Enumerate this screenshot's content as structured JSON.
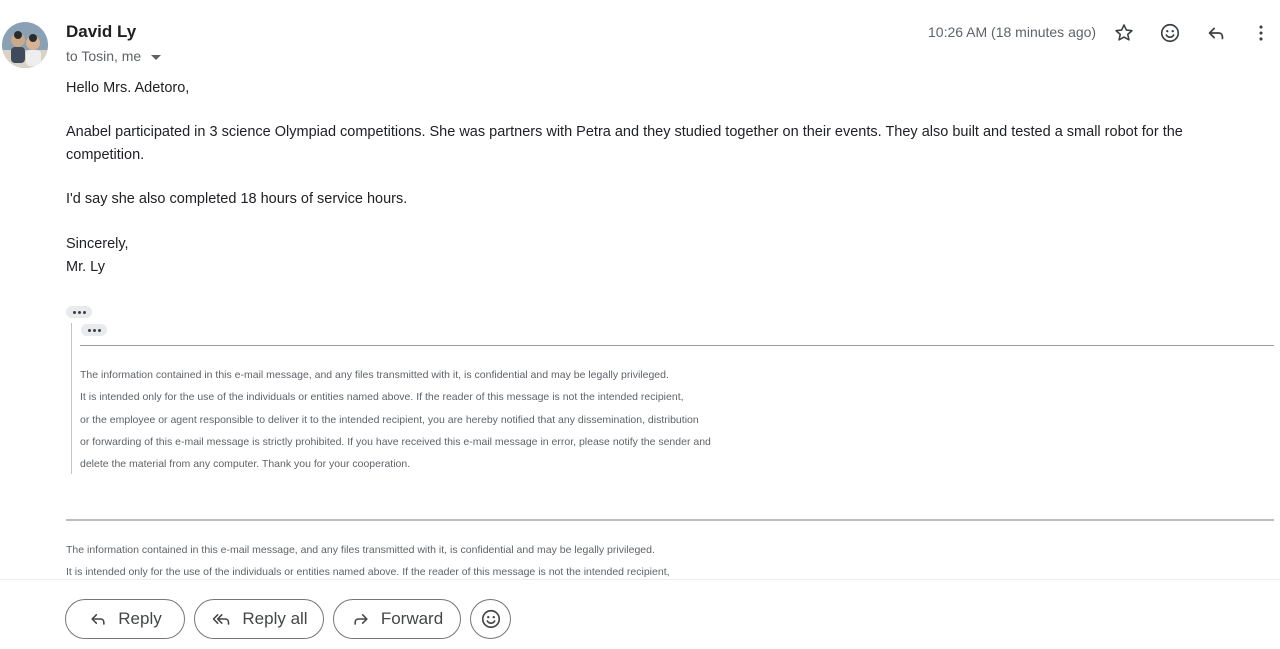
{
  "header": {
    "sender_name": "David Ly",
    "recipients": "to Tosin, me",
    "timestamp": "10:26 AM (18 minutes ago)",
    "icons": [
      "star-icon",
      "emoji-reaction-icon",
      "reply-icon",
      "more-vert-icon"
    ]
  },
  "message": {
    "greeting": "Hello Mrs. Adetoro,",
    "paragraph1": "Anabel participated in 3 science Olympiad competitions.  She was partners with Petra and they studied together on their events.  They also built and tested a small robot for the competition.",
    "paragraph2": "I'd say she also completed 18 hours of service hours.",
    "closing": "Sincerely,",
    "signature": "Mr. Ly"
  },
  "quoted_disclaimer": [
    "The information contained in this e-mail message, and any files transmitted with it, is confidential and may be legally privileged.",
    "It is intended only for the use of the individuals or entities named above. If the reader of this message is not the intended recipient,",
    "or the employee or agent responsible to deliver it to the intended recipient, you are hereby notified that any dissemination, distribution",
    "or forwarding of this e-mail message is strictly prohibited. If you have received this e-mail message in error, please notify the sender and",
    "delete the material from any computer. Thank you for your cooperation."
  ],
  "footer_disclaimer": [
    "The information contained in this e-mail message, and any files transmitted with it, is confidential and may be legally privileged.",
    "It is intended only for the use of the individuals or entities named above. If the reader of this message is not the intended recipient,"
  ],
  "actions": {
    "reply": "Reply",
    "reply_all": "Reply all",
    "forward": "Forward"
  },
  "colors": {
    "text": "#202124",
    "muted": "#5f6368",
    "button_border": "#747775"
  }
}
